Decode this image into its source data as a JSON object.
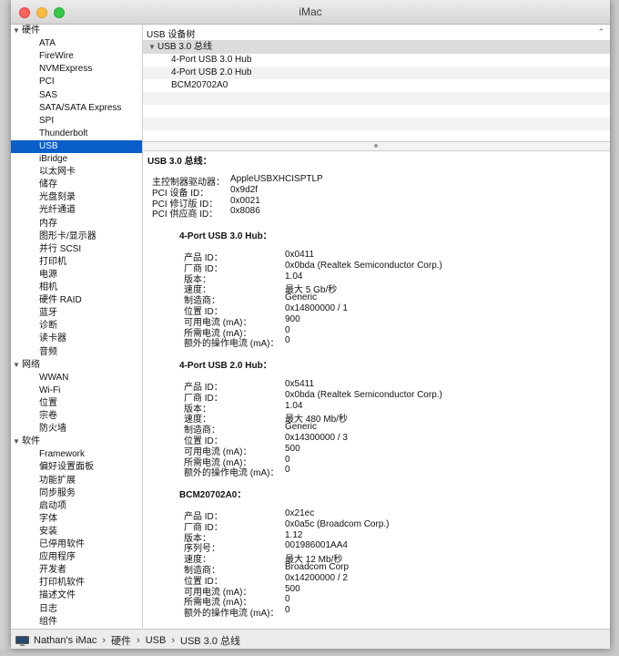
{
  "window": {
    "title": "iMac"
  },
  "sidebar": {
    "categories": [
      {
        "label": "硬件",
        "items": [
          "ATA",
          "FireWire",
          "NVMExpress",
          "PCI",
          "SAS",
          "SATA/SATA Express",
          "SPI",
          "Thunderbolt",
          "USB",
          "iBridge",
          "以太网卡",
          "储存",
          "光盘刻录",
          "光纤通道",
          "内存",
          "图形卡/显示器",
          "并行 SCSI",
          "打印机",
          "电源",
          "相机",
          "硬件 RAID",
          "蓝牙",
          "诊断",
          "读卡器",
          "音频"
        ]
      },
      {
        "label": "网络",
        "items": [
          "WWAN",
          "Wi-Fi",
          "位置",
          "宗卷",
          "防火墙"
        ]
      },
      {
        "label": "软件",
        "items": [
          "Framework",
          "偏好设置面板",
          "功能扩展",
          "同步服务",
          "启动项",
          "字体",
          "安装",
          "已停用软件",
          "应用程序",
          "开发者",
          "打印机软件",
          "描述文件",
          "日志",
          "组件"
        ]
      }
    ],
    "selected": "USB"
  },
  "usb_tree": {
    "header": "USB 设备树",
    "bus": "USB 3.0 总线",
    "devices": [
      "4-Port USB 3.0 Hub",
      "4-Port USB 2.0 Hub",
      "BCM20702A0"
    ]
  },
  "detail": {
    "title": "USB 3.0 总线：",
    "bus_props": [
      {
        "k": "主控制器驱动器：",
        "v": "AppleUSBXHCISPTLP"
      },
      {
        "k": "PCI 设备 ID：",
        "v": "0x9d2f"
      },
      {
        "k": "PCI 修订版 ID：",
        "v": "0x0021"
      },
      {
        "k": "PCI 供应商 ID：",
        "v": "0x8086"
      }
    ],
    "devices": [
      {
        "name": "4-Port USB 3.0 Hub：",
        "props": [
          {
            "k": "产品 ID：",
            "v": "0x0411"
          },
          {
            "k": "厂商 ID：",
            "v": "0x0bda  (Realtek Semiconductor Corp.)"
          },
          {
            "k": "版本：",
            "v": "1.04"
          },
          {
            "k": "速度：",
            "v": "最大 5 Gb/秒"
          },
          {
            "k": "制造商：",
            "v": "Generic"
          },
          {
            "k": "位置 ID：",
            "v": "0x14800000 / 1"
          },
          {
            "k": "可用电流 (mA)：",
            "v": "900"
          },
          {
            "k": "所需电流 (mA)：",
            "v": "0"
          },
          {
            "k": "额外的操作电流 (mA)：",
            "v": "0"
          }
        ]
      },
      {
        "name": "4-Port USB 2.0 Hub：",
        "props": [
          {
            "k": "产品 ID：",
            "v": "0x5411"
          },
          {
            "k": "厂商 ID：",
            "v": "0x0bda  (Realtek Semiconductor Corp.)"
          },
          {
            "k": "版本：",
            "v": "1.04"
          },
          {
            "k": "速度：",
            "v": "最大 480 Mb/秒"
          },
          {
            "k": "制造商：",
            "v": "Generic"
          },
          {
            "k": "位置 ID：",
            "v": "0x14300000 / 3"
          },
          {
            "k": "可用电流 (mA)：",
            "v": "500"
          },
          {
            "k": "所需电流 (mA)：",
            "v": "0"
          },
          {
            "k": "额外的操作电流 (mA)：",
            "v": "0"
          }
        ]
      },
      {
        "name": "BCM20702A0：",
        "props": [
          {
            "k": "产品 ID：",
            "v": "0x21ec"
          },
          {
            "k": "厂商 ID：",
            "v": "0x0a5c  (Broadcom Corp.)"
          },
          {
            "k": "版本：",
            "v": "1.12"
          },
          {
            "k": "序列号：",
            "v": "001986001AA4"
          },
          {
            "k": "速度：",
            "v": "最大 12 Mb/秒"
          },
          {
            "k": "制造商：",
            "v": "Broadcom Corp"
          },
          {
            "k": "位置 ID：",
            "v": "0x14200000 / 2"
          },
          {
            "k": "可用电流 (mA)：",
            "v": "500"
          },
          {
            "k": "所需电流 (mA)：",
            "v": "0"
          },
          {
            "k": "额外的操作电流 (mA)：",
            "v": "0"
          }
        ]
      }
    ]
  },
  "pathbar": {
    "crumbs": [
      "Nathan's iMac",
      "硬件",
      "USB",
      "USB 3.0 总线"
    ],
    "separator": "›"
  }
}
